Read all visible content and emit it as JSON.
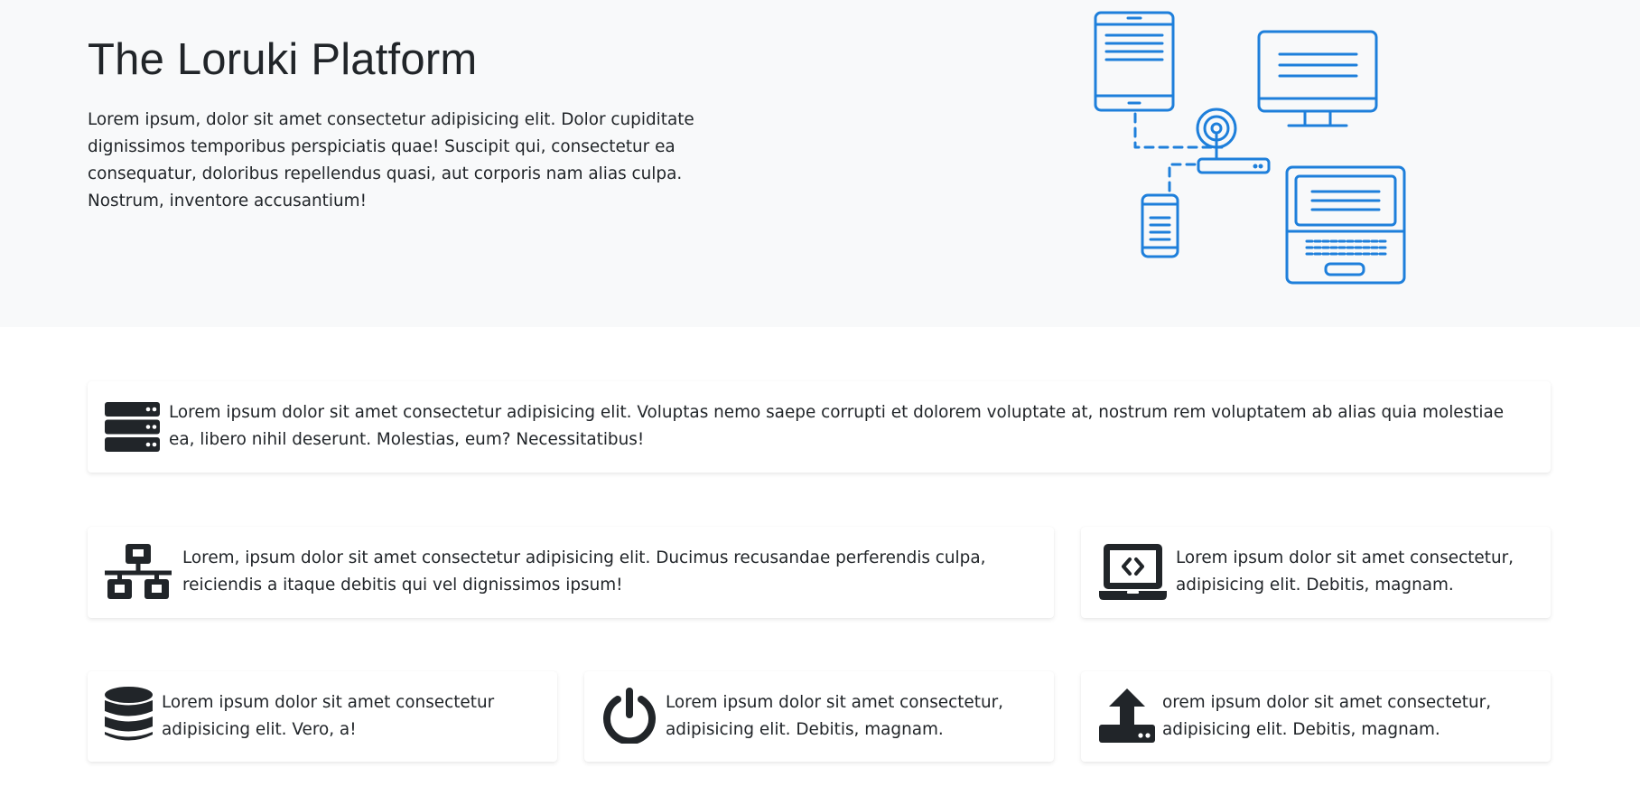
{
  "hero": {
    "title": "The Loruki Platform",
    "lead": "Lorem ipsum, dolor sit amet consectetur adipisicing elit. Dolor cupiditate dignissimos temporibus perspiciatis quae! Suscipit qui, consectetur ea consequatur, doloribus repellendus quasi, aut corporis nam alias culpa. Nostrum, inventore accusantium!",
    "illustration_icon": "connected-devices-icon",
    "accent_color": "#1e7fdb"
  },
  "features": [
    {
      "icon": "server-icon",
      "text": "Lorem ipsum dolor sit amet consectetur adipisicing elit. Voluptas nemo saepe corrupti et dolorem voluptate at, nostrum rem voluptatem ab alias quia molestiae ea, libero nihil deserunt. Molestias, eum? Necessitatibus!"
    },
    {
      "icon": "network-icon",
      "text": "Lorem, ipsum dolor sit amet consectetur adipisicing elit. Ducimus recusandae perferendis culpa, reiciendis a itaque debitis qui vel dignissimos ipsum!"
    },
    {
      "icon": "laptop-code-icon",
      "text": "Lorem ipsum dolor sit amet consectetur, adipisicing elit. Debitis, magnam."
    },
    {
      "icon": "database-icon",
      "text": "Lorem ipsum dolor sit amet consectetur adipisicing elit. Vero, a!"
    },
    {
      "icon": "power-off-icon",
      "text": "Lorem ipsum dolor sit amet consectetur, adipisicing elit. Debitis, magnam."
    },
    {
      "icon": "upload-icon",
      "text": "orem ipsum dolor sit amet consectetur, adipisicing elit. Debitis, magnam."
    }
  ]
}
